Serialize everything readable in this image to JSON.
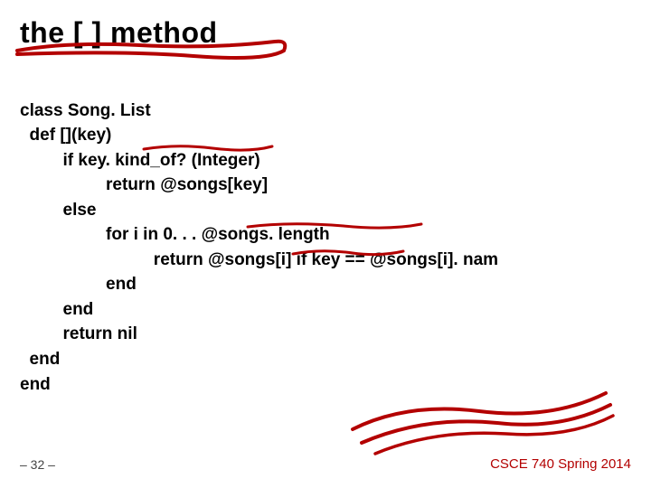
{
  "title": "the  [ ] method",
  "code": {
    "l1": "class Song. List",
    "l2": "  def [](key)",
    "l3": "         if key. kind_of? (Integer)",
    "l4": "                  return @songs[key]",
    "l5": "         else",
    "l6": "                  for i in 0. . . @songs. length",
    "l7": "                            return @songs[i] if key == @songs[i]. nam",
    "l8": "                  end",
    "l9": "         end",
    "l10": "         return nil",
    "l11": "  end",
    "l12": "end"
  },
  "footer": {
    "left": "– 32 –",
    "right": "CSCE 740 Spring 2014"
  }
}
